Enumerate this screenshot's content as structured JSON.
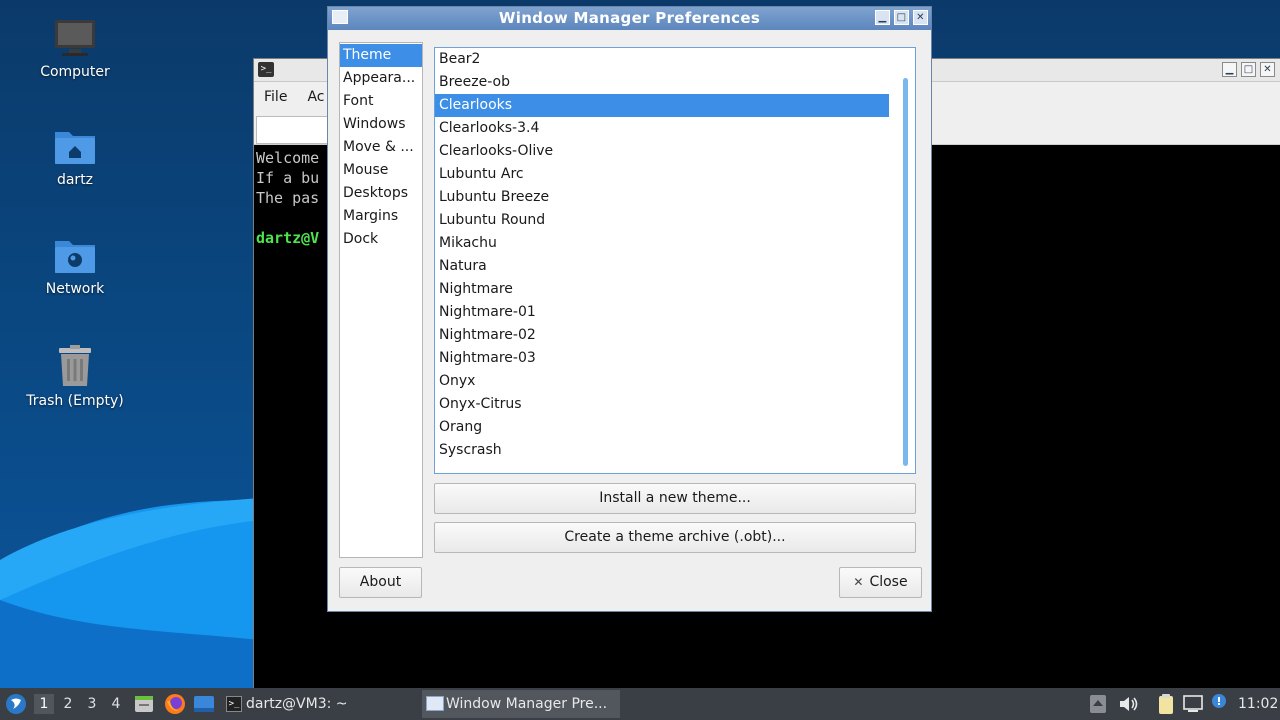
{
  "desktop": {
    "icons": [
      {
        "label": "Computer"
      },
      {
        "label": "dartz"
      },
      {
        "label": "Network"
      },
      {
        "label": "Trash (Empty)"
      }
    ]
  },
  "terminal": {
    "menu": [
      "File",
      "Ac"
    ],
    "lines": [
      "Welcome",
      "If a bu",
      "The pas",
      "",
      "dartz@V"
    ]
  },
  "dialog": {
    "title": "Window Manager Preferences",
    "categories": [
      "Theme",
      "Appeara...",
      "Font",
      "Windows",
      "Move & ...",
      "Mouse",
      "Desktops",
      "Margins",
      "Dock"
    ],
    "selected_category": "Theme",
    "themes": [
      "Bear2",
      "Breeze-ob",
      "Clearlooks",
      "Clearlooks-3.4",
      "Clearlooks-Olive",
      "Lubuntu Arc",
      "Lubuntu Breeze",
      "Lubuntu Round",
      "Mikachu",
      "Natura",
      "Nightmare",
      "Nightmare-01",
      "Nightmare-02",
      "Nightmare-03",
      "Onyx",
      "Onyx-Citrus",
      "Orang",
      "Syscrash"
    ],
    "selected_theme": "Clearlooks",
    "install_label": "Install a new theme...",
    "archive_label": "Create a theme archive (.obt)...",
    "about_label": "About",
    "close_label": "Close",
    "close_glyph": "✕"
  },
  "taskbar": {
    "workspaces": [
      "1",
      "2",
      "3",
      "4"
    ],
    "active_workspace": "1",
    "tasks": [
      {
        "label": "dartz@VM3: ~"
      },
      {
        "label": "Window Manager Pre..."
      }
    ],
    "clock": "11:02"
  }
}
